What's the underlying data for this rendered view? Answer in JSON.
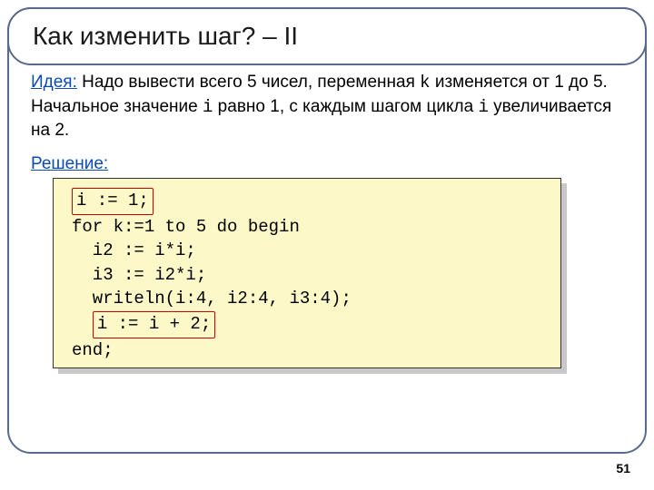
{
  "slide": {
    "title": "Как изменить шаг? – II",
    "idea": {
      "label": "Идея:",
      "part1": " Надо вывести всего 5 чисел, переменная ",
      "var_k": "k",
      "part2": " изменяется от 1 до 5. Начальное значение ",
      "var_i": "i",
      "part3": " равно 1, с каждым шагом цикла ",
      "var_i2": "i",
      "part4": " увеличивается на 2."
    },
    "solution_label": "Решение:",
    "code": {
      "line1_hl": "i := 1;",
      "line2": "for k:=1 to 5 do begin",
      "line3": "  i2 := i*i;",
      "line4": "  i3 := i2*i;",
      "line5": "  writeln(i:4, i2:4, i3:4);",
      "line6_hl": "i := i + 2;",
      "line7": "end;"
    },
    "page_number": "51"
  }
}
